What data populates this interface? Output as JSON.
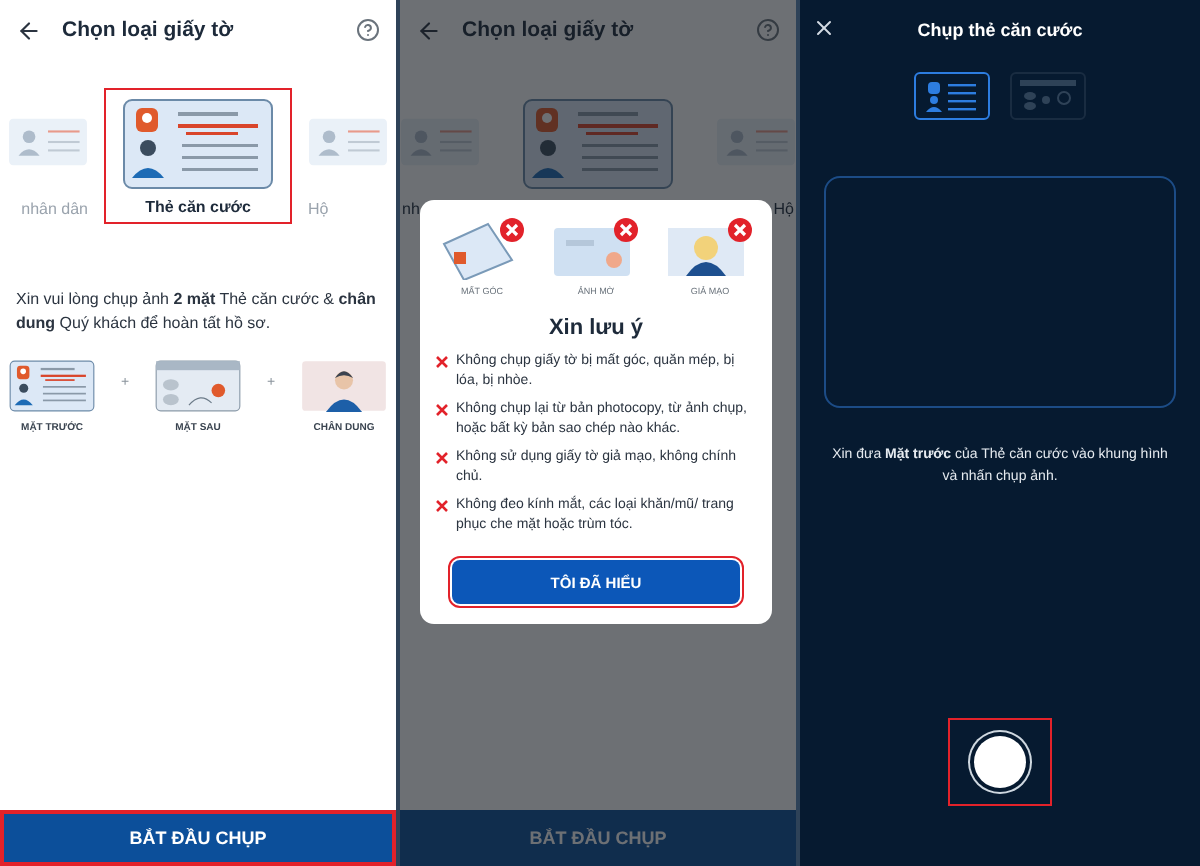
{
  "select_screen": {
    "title": "Chọn loại giấy tờ",
    "doc_types": [
      {
        "label": "nhân dân",
        "selected": false,
        "kind": "side"
      },
      {
        "label": "Thẻ căn cước",
        "selected": true,
        "kind": "center"
      },
      {
        "label": "Hộ",
        "selected": false,
        "kind": "side"
      }
    ],
    "instruction": "Xin vui lòng chụp ảnh **2 mặt** Thẻ căn cước & **chân dung** Quý khách để hoàn tất hồ sơ.",
    "steps": [
      {
        "label": "MẶT TRƯỚC",
        "kind": "front"
      },
      {
        "prefix": "+",
        "label": "MẶT SAU",
        "kind": "back"
      },
      {
        "prefix": "+",
        "label": "CHÂN DUNG",
        "kind": "portrait"
      }
    ],
    "primary_button": {
      "label": "BẮT ĐẦU CHỤP",
      "highlighted": true
    }
  },
  "notice_screen": {
    "title": "Chọn loại giấy tờ",
    "doc_types": [
      {
        "label": "nh",
        "kind": "side"
      },
      {
        "kind": "center"
      },
      {
        "label": "Hộ",
        "kind": "side"
      }
    ],
    "primary_button": {
      "label": "BẮT ĐẦU CHỤP"
    },
    "dialog": {
      "issues": [
        {
          "label": "MẤT GÓC",
          "kind": "corner"
        },
        {
          "label": "ẢNH MỜ",
          "kind": "blur"
        },
        {
          "label": "GIẢ MẠO",
          "kind": "fake"
        }
      ],
      "title": "Xin lưu ý",
      "rules": [
        "Không chụp giấy tờ bị mất góc, quăn mép, bị lóa, bị nhòe.",
        "Không chụp lại từ bản photocopy, từ ảnh chụp, hoặc bất kỳ bản sao chép nào khác.",
        "Không sử dụng giấy tờ giả mạo, không chính chủ.",
        "Không đeo kính mắt, các loại khăn/mũ/ trang phục che mặt hoặc trùm tóc."
      ],
      "button": {
        "label": "TÔI ĐÃ HIỂU",
        "highlighted": true
      }
    }
  },
  "camera_screen": {
    "title": "Chụp thẻ căn cước",
    "sides": [
      {
        "kind": "front",
        "selected": true
      },
      {
        "kind": "back",
        "selected": false
      }
    ],
    "hint": "Xin đưa **Mặt trước** của Thẻ căn cước vào khung hình và nhấn chụp ảnh.",
    "shutter": {
      "highlighted": true
    }
  }
}
